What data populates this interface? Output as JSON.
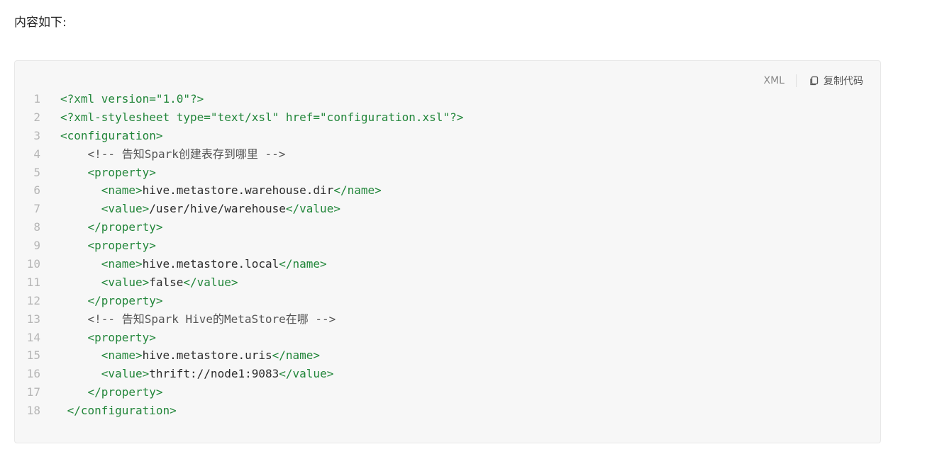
{
  "intro_text": "内容如下:",
  "code_block": {
    "language": "XML",
    "copy_label": "复制代码",
    "copy_icon": "copy-icon",
    "colors": {
      "background": "#f7f7f7",
      "tag": "#22863a",
      "text": "#2b2b2b",
      "line_number": "#b6b6b6"
    },
    "lines": [
      {
        "num": "1",
        "indent": "",
        "parts": [
          {
            "t": "tag",
            "v": "<?xml version=\"1.0\"?>"
          }
        ]
      },
      {
        "num": "2",
        "indent": "",
        "parts": [
          {
            "t": "tag",
            "v": "<?xml-stylesheet type=\"text/xsl\" href=\"configuration.xsl\"?>"
          }
        ]
      },
      {
        "num": "3",
        "indent": "",
        "parts": [
          {
            "t": "tag",
            "v": "<configuration>"
          }
        ]
      },
      {
        "num": "4",
        "indent": "    ",
        "parts": [
          {
            "t": "cmt",
            "v": "<!-- 告知Spark创建表存到哪里 -->"
          }
        ]
      },
      {
        "num": "5",
        "indent": "    ",
        "parts": [
          {
            "t": "tag",
            "v": "<property>"
          }
        ]
      },
      {
        "num": "6",
        "indent": "      ",
        "parts": [
          {
            "t": "tag",
            "v": "<name>"
          },
          {
            "t": "txt",
            "v": "hive.metastore.warehouse.dir"
          },
          {
            "t": "tag",
            "v": "</name>"
          }
        ]
      },
      {
        "num": "7",
        "indent": "      ",
        "parts": [
          {
            "t": "tag",
            "v": "<value>"
          },
          {
            "t": "txt",
            "v": "/user/hive/warehouse"
          },
          {
            "t": "tag",
            "v": "</value>"
          }
        ]
      },
      {
        "num": "8",
        "indent": "    ",
        "parts": [
          {
            "t": "tag",
            "v": "</property>"
          }
        ]
      },
      {
        "num": "9",
        "indent": "    ",
        "parts": [
          {
            "t": "tag",
            "v": "<property>"
          }
        ]
      },
      {
        "num": "10",
        "indent": "      ",
        "parts": [
          {
            "t": "tag",
            "v": "<name>"
          },
          {
            "t": "txt",
            "v": "hive.metastore.local"
          },
          {
            "t": "tag",
            "v": "</name>"
          }
        ]
      },
      {
        "num": "11",
        "indent": "      ",
        "parts": [
          {
            "t": "tag",
            "v": "<value>"
          },
          {
            "t": "txt",
            "v": "false"
          },
          {
            "t": "tag",
            "v": "</value>"
          }
        ]
      },
      {
        "num": "12",
        "indent": "    ",
        "parts": [
          {
            "t": "tag",
            "v": "</property>"
          }
        ]
      },
      {
        "num": "13",
        "indent": "    ",
        "parts": [
          {
            "t": "cmt",
            "v": "<!-- 告知Spark Hive的MetaStore在哪 -->"
          }
        ]
      },
      {
        "num": "14",
        "indent": "    ",
        "parts": [
          {
            "t": "tag",
            "v": "<property>"
          }
        ]
      },
      {
        "num": "15",
        "indent": "      ",
        "parts": [
          {
            "t": "tag",
            "v": "<name>"
          },
          {
            "t": "txt",
            "v": "hive.metastore.uris"
          },
          {
            "t": "tag",
            "v": "</name>"
          }
        ]
      },
      {
        "num": "16",
        "indent": "      ",
        "parts": [
          {
            "t": "tag",
            "v": "<value>"
          },
          {
            "t": "txt",
            "v": "thrift://node1:9083"
          },
          {
            "t": "tag",
            "v": "</value>"
          }
        ]
      },
      {
        "num": "17",
        "indent": "    ",
        "parts": [
          {
            "t": "tag",
            "v": "</property>"
          }
        ]
      },
      {
        "num": "18",
        "indent": " ",
        "parts": [
          {
            "t": "tag",
            "v": "</configuration>"
          }
        ]
      }
    ]
  }
}
